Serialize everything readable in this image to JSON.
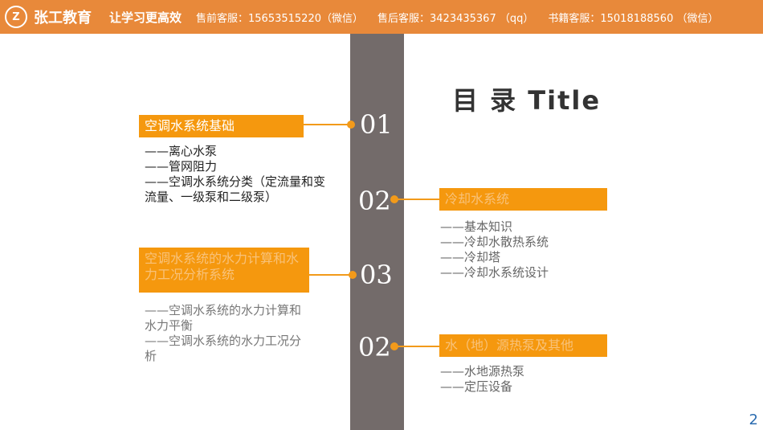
{
  "header": {
    "logo_glyph": "Z",
    "brand": "张工教育",
    "slogan": "让学习更高效",
    "contacts": [
      "售前客服：15653515220（微信）",
      "售后客服：3423435367 （qq）",
      "书籍客服：15018188560 （微信）"
    ]
  },
  "title": "目 录 Title",
  "sections": [
    {
      "number": "01",
      "heading": "空调水系统基础",
      "items": [
        "——离心水泵",
        "——管网阻力",
        "——空调水系统分类（定流量和变流量、一级泵和二级泵）"
      ]
    },
    {
      "number": "02",
      "heading": "冷却水系统",
      "items": [
        "——基本知识",
        "——冷却水散热系统",
        "——冷却塔",
        "——冷却水系统设计"
      ]
    },
    {
      "number": "03",
      "heading": "空调水系统的水力计算和水力工况分析系统",
      "items": [
        "——空调水系统的水力计算和水力平衡",
        "——空调水系统的水力工况分析"
      ]
    },
    {
      "number": "02",
      "heading": "水（地）源热泵及其他",
      "items": [
        "——水地源热泵",
        "——定压设备"
      ]
    }
  ],
  "page_number": "2",
  "colors": {
    "header": "#e8893a",
    "accent": "#f5980e",
    "spine": "#736b6a"
  }
}
